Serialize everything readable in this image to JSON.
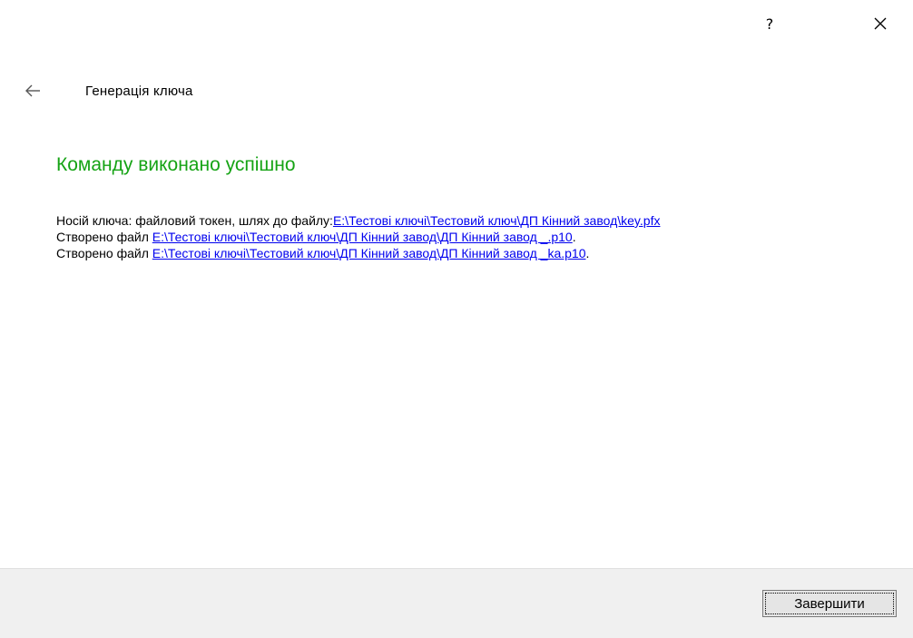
{
  "titlebar": {
    "help_label": "?"
  },
  "header": {
    "title": "Генерація  ключа"
  },
  "result": {
    "title": "Команду виконано успішно",
    "messages": [
      {
        "prefix": "Носій ключа: файловий токен, шлях до файлу:",
        "link": "E:\\Тестові ключі\\Тестовий ключ\\ДП Кінний завод\\key.pfx",
        "suffix": ""
      },
      {
        "prefix": "Створено файл ",
        "link": "E:\\Тестові ключі\\Тестовий ключ\\ДП Кінний завод\\ДП Кінний завод _.p10",
        "suffix": "."
      },
      {
        "prefix": "Створено файл ",
        "link": "E:\\Тестові ключі\\Тестовий ключ\\ДП Кінний завод\\ДП Кінний завод _ka.p10",
        "suffix": "."
      }
    ]
  },
  "footer": {
    "finish_label": "Завершити"
  },
  "colors": {
    "success": "#15a314",
    "link": "#0000ee",
    "footer_bg": "#f0f0f0"
  },
  "icons": {
    "help": "question-mark",
    "close": "close-x",
    "back": "left-arrow"
  }
}
